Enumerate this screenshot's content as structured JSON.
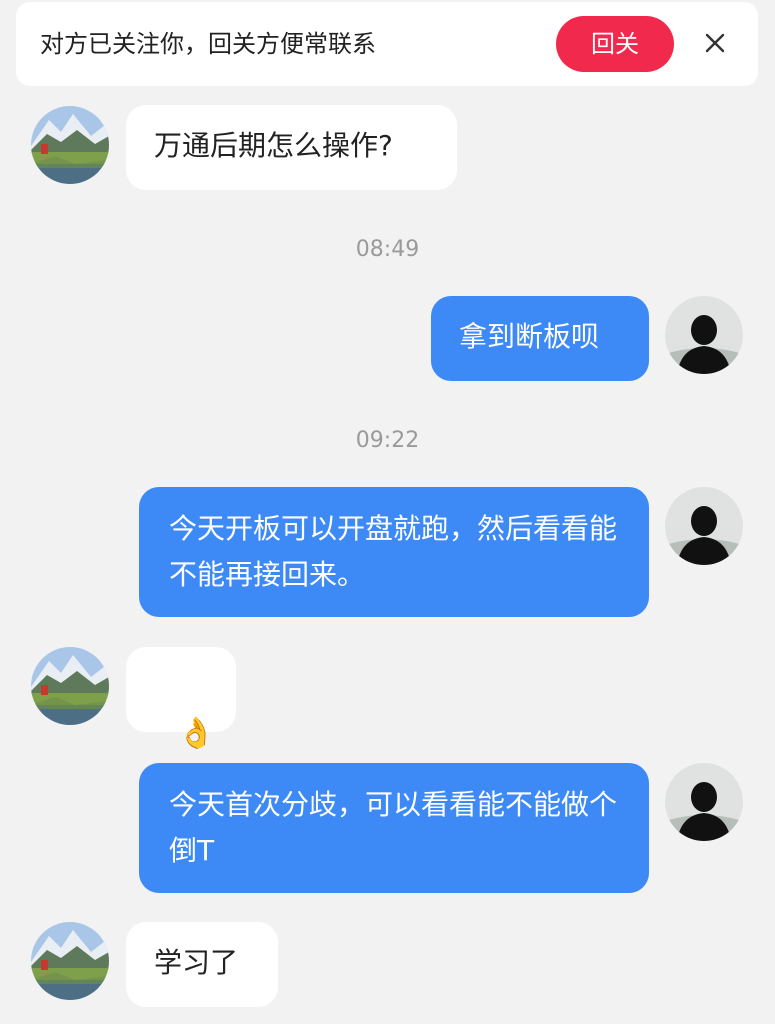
{
  "banner": {
    "text": "对方已关注你，回关方便常联系",
    "follow_label": "回关",
    "close_icon": "close-icon",
    "accent_color": "#f0294d"
  },
  "messages": [
    {
      "side": "in",
      "text": "万通后期怎么操作?"
    },
    {
      "type": "time",
      "text": "08:49"
    },
    {
      "side": "out",
      "text": "拿到断板呗"
    },
    {
      "type": "time",
      "text": "09:22"
    },
    {
      "side": "out",
      "text": "今天开板可以开盘就跑，然后看看能不能再接回来。"
    },
    {
      "side": "in",
      "text": "👌",
      "emoji_name": "ok-hand-icon"
    },
    {
      "side": "out",
      "text": "今天首次分歧，可以看看能不能做个倒T"
    },
    {
      "side": "in",
      "text": "学习了"
    }
  ],
  "colors": {
    "background": "#f2f2f2",
    "bubble_out": "#3d8af7",
    "bubble_in": "#ffffff",
    "timestamp": "#9a9a9a"
  }
}
